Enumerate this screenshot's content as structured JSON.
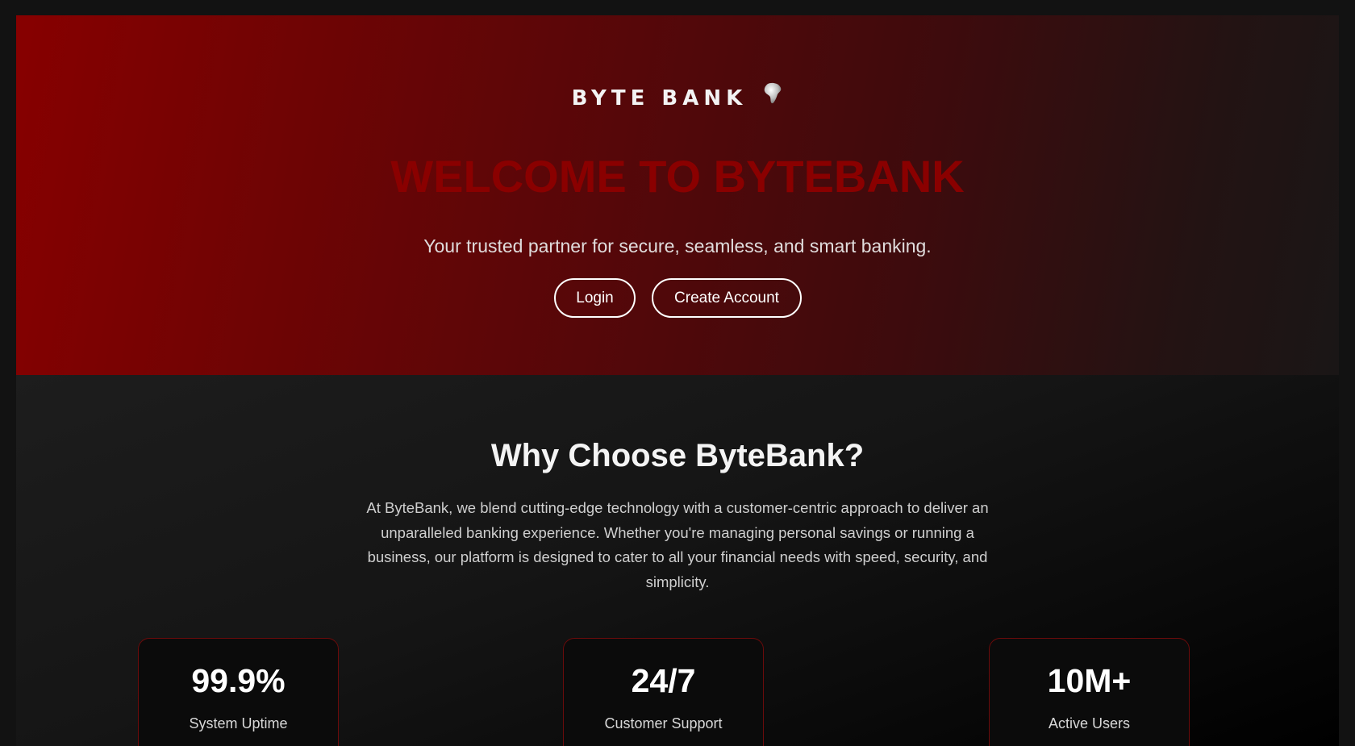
{
  "hero": {
    "logo_text": "BYTE BANK",
    "logo_icon": "africa-globe-icon",
    "title": "WELCOME TO BYTEBANK",
    "subtitle": "Your trusted partner for secure, seamless, and smart banking.",
    "login_label": "Login",
    "create_account_label": "Create Account"
  },
  "features": {
    "title": "Why Choose ByteBank?",
    "description": "At ByteBank, we blend cutting-edge technology with a customer-centric approach to deliver an unparalleled banking experience. Whether you're managing personal savings or running a business, our platform is designed to cater to all your financial needs with speed, security, and simplicity.",
    "stats": [
      {
        "value": "99.9%",
        "label": "System Uptime"
      },
      {
        "value": "24/7",
        "label": "Customer Support"
      },
      {
        "value": "10M+",
        "label": "Active Users"
      }
    ]
  },
  "colors": {
    "accent_red": "#8a0000",
    "card_border": "#6b0b0b",
    "page_background": "#121212"
  }
}
